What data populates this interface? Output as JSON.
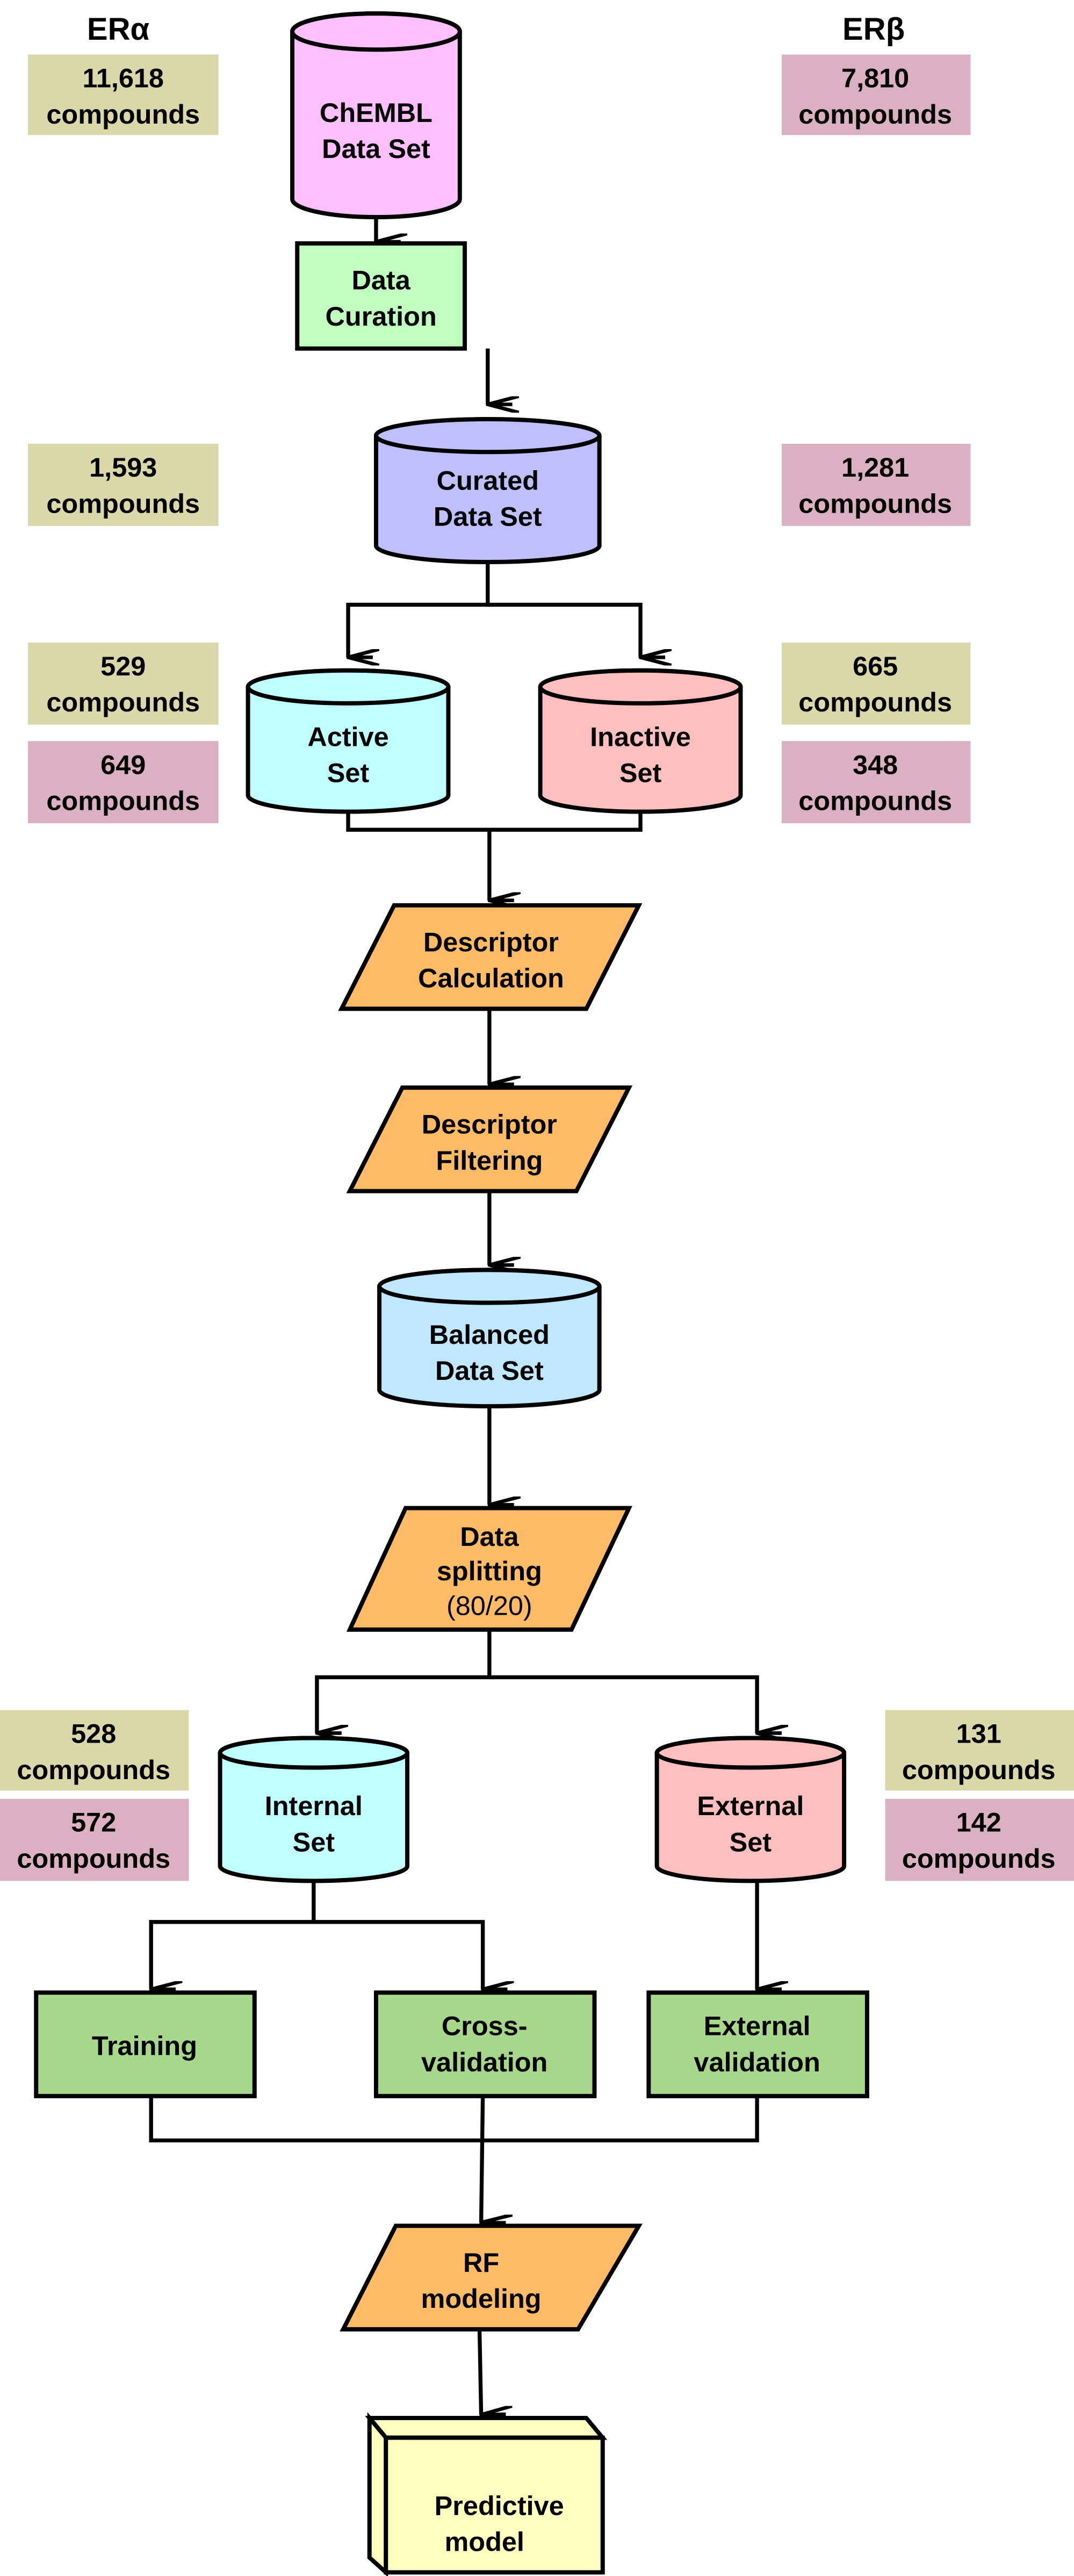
{
  "headers": {
    "left": "ERα",
    "right": "ERβ"
  },
  "colors": {
    "era_badge": "#dad7aa",
    "erb_badge": "#dbb0c3",
    "chembl": "#fdbffd",
    "curation": "#bfffbf",
    "curated": "#bfbffd",
    "active": "#bfffff",
    "inactive": "#ffbfbf",
    "process": "#ffbb66",
    "balanced": "#bfe8ff",
    "internal": "#bfffff",
    "external": "#ffbfbf",
    "validation": "#a6d78a",
    "model": "#ffffbf"
  },
  "badges": {
    "chembl_era": [
      "11,618",
      "compounds"
    ],
    "chembl_erb": [
      "7,810",
      "compounds"
    ],
    "curated_era": [
      "1,593",
      "compounds"
    ],
    "curated_erb": [
      "1,281",
      "compounds"
    ],
    "active_era": [
      "529",
      "compounds"
    ],
    "active_erb": [
      "649",
      "compounds"
    ],
    "inactive_era": [
      "665",
      "compounds"
    ],
    "inactive_erb": [
      "348",
      "compounds"
    ],
    "internal_era": [
      "528",
      "compounds"
    ],
    "internal_erb": [
      "572",
      "compounds"
    ],
    "external_era": [
      "131",
      "compounds"
    ],
    "external_erb": [
      "142",
      "compounds"
    ]
  },
  "nodes": {
    "chembl": [
      "ChEMBL",
      "Data Set"
    ],
    "curation": [
      "Data",
      "Curation"
    ],
    "curated": [
      "Curated",
      "Data Set"
    ],
    "active": [
      "Active",
      "Set"
    ],
    "inactive": [
      "Inactive",
      "Set"
    ],
    "desc_calc": [
      "Descriptor",
      "Calculation"
    ],
    "desc_filt": [
      "Descriptor",
      "Filtering"
    ],
    "balanced": [
      "Balanced",
      "Data Set"
    ],
    "splitting": [
      "Data",
      "splitting",
      "(80/20)"
    ],
    "internal": [
      "Internal",
      "Set"
    ],
    "external": [
      "External",
      "Set"
    ],
    "training": [
      "Training"
    ],
    "cross": [
      "Cross-",
      "validation"
    ],
    "ext_val": [
      "External",
      "validation"
    ],
    "rf": [
      "RF",
      "modeling"
    ],
    "model": [
      "Predictive",
      "model"
    ]
  }
}
